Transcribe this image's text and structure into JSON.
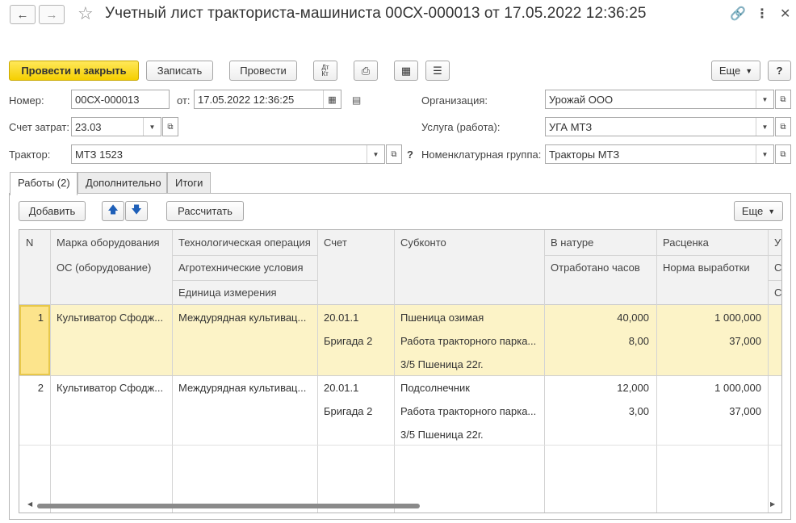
{
  "window": {
    "title": "Учетный лист тракториста-машиниста 00СХ-000013 от 17.05.2022 12:36:25",
    "back_icon": "arrow-left-icon",
    "forward_icon": "arrow-right-icon"
  },
  "toolbar": {
    "post_close": "Провести и закрыть",
    "save": "Записать",
    "post": "Провести",
    "dtkt": "Дт/Кт",
    "more": "Еще",
    "help": "?"
  },
  "form": {
    "number_label": "Номер:",
    "number_value": "00СХ-000013",
    "date_label": "от:",
    "date_value": "17.05.2022 12:36:25",
    "cost_account_label": "Счет затрат:",
    "cost_account_value": "23.03",
    "tractor_label": "Трактор:",
    "tractor_value": "МТЗ 1523",
    "tractor_help": "?",
    "org_label": "Организация:",
    "org_value": "Урожай ООО",
    "service_label": "Услуга (работа):",
    "service_value": "УГА МТЗ",
    "nomgroup_label": "Номенклатурная группа:",
    "nomgroup_value": "Тракторы МТЗ"
  },
  "tabs": [
    {
      "label": "Работы (2)",
      "active": true
    },
    {
      "label": "Дополнительно",
      "active": false
    },
    {
      "label": "Итоги",
      "active": false
    }
  ],
  "works_toolbar": {
    "add": "Добавить",
    "calculate": "Рассчитать",
    "more": "Еще"
  },
  "table": {
    "headers": {
      "n": "N",
      "equipment": "Марка оборудования",
      "os": "ОС (оборудование)",
      "operation": "Технологическая операция",
      "agro": "Агротехнические условия",
      "unit": "Единица измерения",
      "account": "Счет",
      "subconto": "Субконто",
      "in_kind": "В натуре",
      "hours": "Отработано часов",
      "rate": "Расценка",
      "norm": "Норма выработки",
      "next1": "У",
      "next2": "С",
      "next3": "С"
    },
    "rows": [
      {
        "n": "1",
        "equipment": "Культиватор Сфодж...",
        "operation": "Междурядная культивац...",
        "account": "20.01.1",
        "account2": "Бригада 2",
        "sub1": "Пшеница озимая",
        "sub2": "Работа тракторного парка...",
        "sub3": "3/5 Пшеница 22г.",
        "in_kind": "40,000",
        "hours": "8,00",
        "rate": "1 000,000",
        "norm": "37,000"
      },
      {
        "n": "2",
        "equipment": "Культиватор Сфодж...",
        "operation": "Междурядная культивац...",
        "account": "20.01.1",
        "account2": "Бригада 2",
        "sub1": "Подсолнечник",
        "sub2": "Работа тракторного парка...",
        "sub3": "3/5 Пшеница 22г.",
        "in_kind": "12,000",
        "hours": "3,00",
        "rate": "1 000,000",
        "norm": "37,000"
      }
    ]
  }
}
